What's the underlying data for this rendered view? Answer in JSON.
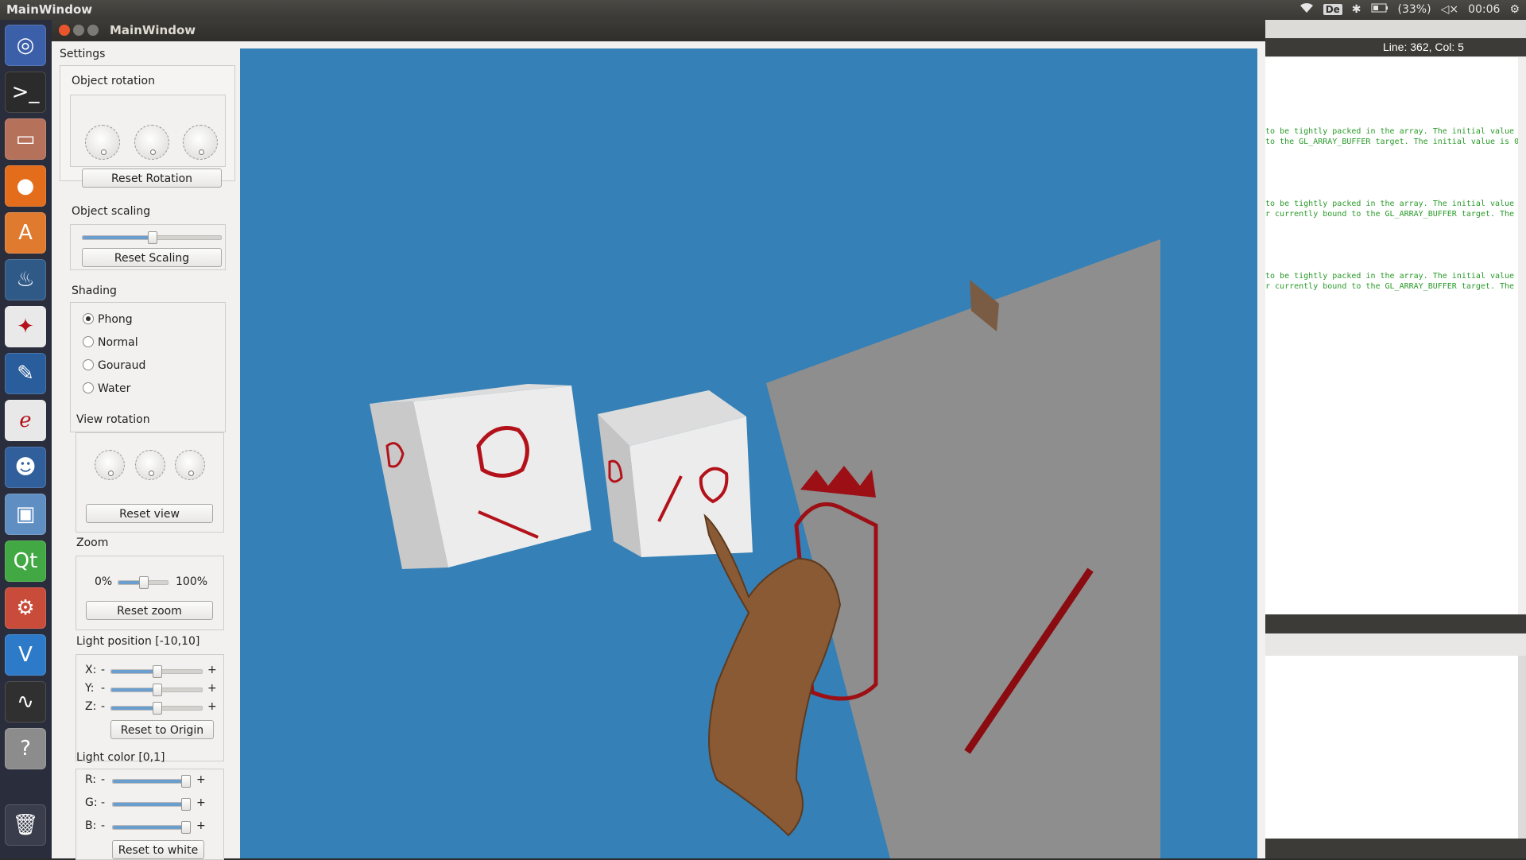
{
  "top_panel": {
    "app_name": "MainWindow",
    "keyboard_layout": "De",
    "battery": "(33%)",
    "clock": "00:06"
  },
  "launcher": {
    "items": [
      {
        "name": "ubuntu-dash",
        "glyph": "◎",
        "color": "#3b5fa8"
      },
      {
        "name": "terminal",
        "glyph": ">_",
        "color": "#2b2b2b"
      },
      {
        "name": "files",
        "glyph": "▭",
        "color": "#b5715a"
      },
      {
        "name": "firefox",
        "glyph": "●",
        "color": "#e36d1b"
      },
      {
        "name": "software-center",
        "glyph": "A",
        "color": "#e07a2e"
      },
      {
        "name": "teapot",
        "glyph": "♨",
        "color": "#2f5a88"
      },
      {
        "name": "inkscape-like",
        "glyph": "✦",
        "color": "#e9e9e9"
      },
      {
        "name": "paint",
        "glyph": "✎",
        "color": "#2a5d9c"
      },
      {
        "name": "document-viewer",
        "glyph": "ℯ",
        "color": "#e8e8e8"
      },
      {
        "name": "pidgin",
        "glyph": "☻",
        "color": "#315f9c"
      },
      {
        "name": "virtualbox",
        "glyph": "▣",
        "color": "#5f8fc2"
      },
      {
        "name": "qt-creator",
        "glyph": "Qt",
        "color": "#41a843"
      },
      {
        "name": "system-settings",
        "glyph": "⚙",
        "color": "#c94b3a"
      },
      {
        "name": "vscode",
        "glyph": "V",
        "color": "#2c7ac8"
      },
      {
        "name": "system-monitor",
        "glyph": "∿",
        "color": "#303030"
      },
      {
        "name": "help",
        "glyph": "?",
        "color": "#8c8c8c"
      },
      {
        "name": "trash",
        "glyph": "🗑",
        "color": "#3a3d4c"
      }
    ]
  },
  "window": {
    "title": "MainWindow"
  },
  "settings": {
    "title": "Settings",
    "object_rotation": {
      "label": "Object rotation",
      "reset": "Reset Rotation"
    },
    "object_scaling": {
      "label": "Object scaling",
      "reset": "Reset Scaling",
      "value": 0.5
    },
    "shading": {
      "label": "Shading",
      "options": [
        "Phong",
        "Normal",
        "Gouraud",
        "Water"
      ],
      "selected": "Phong"
    },
    "view_rotation": {
      "label": "View rotation",
      "reset": "Reset view"
    },
    "zoom": {
      "label": "Zoom",
      "min": "0%",
      "max": "100%",
      "reset": "Reset zoom",
      "value": 0.5
    },
    "light_position": {
      "label": "Light position [-10,10]",
      "rows": [
        {
          "axis": "X:",
          "minus": "-",
          "plus": "+",
          "value": 0.5
        },
        {
          "axis": "Y:",
          "minus": "-",
          "plus": "+",
          "value": 0.5
        },
        {
          "axis": "Z:",
          "minus": "-",
          "plus": "+",
          "value": 0.5
        }
      ],
      "reset": "Reset to Origin"
    },
    "light_color": {
      "label": "Light color [0,1]",
      "rows": [
        {
          "axis": "R:",
          "minus": "-",
          "plus": "+",
          "value": 1.0
        },
        {
          "axis": "G:",
          "minus": "-",
          "plus": "+",
          "value": 1.0
        },
        {
          "axis": "B:",
          "minus": "-",
          "plus": "+",
          "value": 1.0
        }
      ],
      "reset": "Reset to white"
    }
  },
  "editor": {
    "status": "Line: 362, Col: 5",
    "code_lines": [
      "to be tightly packed in the array. The initial value",
      "to the GL_ARRAY_BUFFER target. The initial value is 0",
      "to be tightly packed in the array. The initial value",
      "r currently bound to the GL_ARRAY_BUFFER target. The",
      "to be tightly packed in the array. The initial value",
      "r currently bound to the GL_ARRAY_BUFFER target. The"
    ]
  },
  "colors": {
    "viewport_bg": "#3580b6",
    "emblem_red": "#b3121a",
    "cube_face": "#ececec",
    "wall": "#8c8c8c"
  }
}
